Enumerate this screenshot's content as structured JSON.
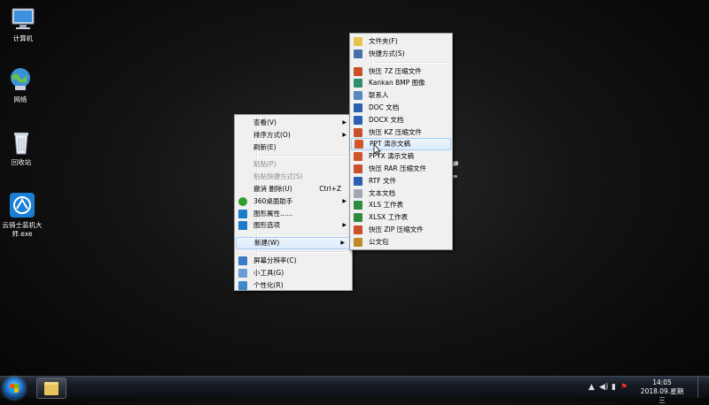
{
  "desktop_icons": [
    {
      "name": "computer-icon",
      "label": "计算机"
    },
    {
      "name": "network-icon",
      "label": "网络"
    },
    {
      "name": "recycle-bin-icon",
      "label": "回收站"
    },
    {
      "name": "app-installer-icon",
      "label": "云骑士装机大师.exe"
    }
  ],
  "context_menu": {
    "items": [
      {
        "label": "查看(V)",
        "submenu": true,
        "icon": ""
      },
      {
        "label": "排序方式(O)",
        "submenu": true,
        "icon": ""
      },
      {
        "label": "刷新(E)",
        "icon": ""
      },
      {
        "sep": true
      },
      {
        "label": "粘贴(P)",
        "disabled": true,
        "icon": ""
      },
      {
        "label": "粘贴快捷方式(S)",
        "disabled": true,
        "icon": ""
      },
      {
        "label": "撤消 删除(U)",
        "shortcut": "Ctrl+Z",
        "icon": ""
      },
      {
        "label": "360桌面助手",
        "submenu": true,
        "icon": "360-icon"
      },
      {
        "label": "图形属性......",
        "icon": "graphics-icon"
      },
      {
        "label": "图形选项",
        "submenu": true,
        "icon": "graphics-icon"
      },
      {
        "sep": true
      },
      {
        "label": "新建(W)",
        "submenu": true,
        "highlight": true,
        "icon": ""
      },
      {
        "sep": true
      },
      {
        "label": "屏幕分辨率(C)",
        "icon": "monitor-icon"
      },
      {
        "label": "小工具(G)",
        "icon": "gadget-icon"
      },
      {
        "label": "个性化(R)",
        "icon": "personalize-icon"
      }
    ]
  },
  "new_submenu": {
    "items": [
      {
        "label": "文件夹(F)",
        "icon": "folder-icon"
      },
      {
        "label": "快捷方式(S)",
        "icon": "shortcut-icon"
      },
      {
        "sep": true
      },
      {
        "label": "快压 7Z 压缩文件",
        "icon": "archive-icon"
      },
      {
        "label": "Kankan BMP 图像",
        "icon": "image-icon"
      },
      {
        "label": "联系人",
        "icon": "contact-icon"
      },
      {
        "label": "DOC 文档",
        "icon": "doc-icon"
      },
      {
        "label": "DOCX 文档",
        "icon": "doc-icon"
      },
      {
        "label": "快压 KZ 压缩文件",
        "icon": "archive-icon"
      },
      {
        "label": "PPT 演示文稿",
        "icon": "ppt-icon",
        "highlight": true
      },
      {
        "label": "PPTX 演示文稿",
        "icon": "ppt-icon"
      },
      {
        "label": "快压 RAR 压缩文件",
        "icon": "archive-icon"
      },
      {
        "label": "RTF 文件",
        "icon": "doc-icon"
      },
      {
        "label": "文本文档",
        "icon": "text-icon"
      },
      {
        "label": "XLS 工作表",
        "icon": "xls-icon"
      },
      {
        "label": "XLSX 工作表",
        "icon": "xls-icon"
      },
      {
        "label": "快压 ZIP 压缩文件",
        "icon": "archive-icon"
      },
      {
        "label": "公文包",
        "icon": "briefcase-icon"
      }
    ]
  },
  "taskbar": {
    "clock_time": "14:05",
    "clock_date": "2018.09.星期三"
  },
  "icon_colors": {
    "360-icon": "#2f9e2f",
    "graphics-icon": "#1d79c9",
    "monitor-icon": "#3a7bc8",
    "gadget-icon": "#6b9bd6",
    "personalize-icon": "#3d88c9",
    "folder-icon": "#e9c14f",
    "shortcut-icon": "#4a6ea8",
    "archive-icon": "#c9502a",
    "image-icon": "#2f8f6b",
    "contact-icon": "#5a86c0",
    "doc-icon": "#2b5fb0",
    "ppt-icon": "#d2552a",
    "text-icon": "#a0a8b4",
    "xls-icon": "#2e8b3e",
    "briefcase-icon": "#c08a2a"
  }
}
